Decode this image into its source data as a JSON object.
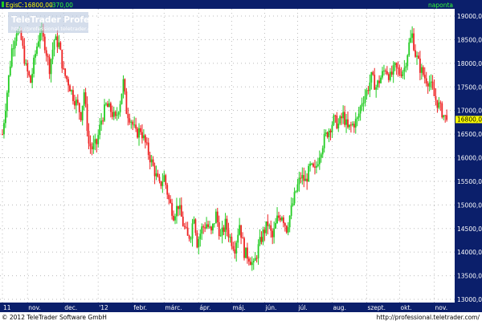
{
  "header": {
    "instrument": "Egis",
    "close_label": "C:",
    "close_value": "16800,00",
    "change": "-370,00",
    "period": "naponta"
  },
  "watermark": {
    "title": "TeleTrader Professional",
    "url": "http://professional.teletrader.com/"
  },
  "footer": {
    "copyright": "© 2012 TeleTrader Software GmbH",
    "url": "http://professional.teletrader.com/"
  },
  "colors": {
    "background": "#ffffff",
    "frame": "#0b1f6b",
    "up": "#22cc22",
    "down": "#ee2222",
    "grid": "#bbbbbb",
    "last_price_bg": "#ffff00",
    "header_text": "#ffff00",
    "header_change": "#33ff33"
  },
  "chart_data": {
    "type": "candlestick",
    "y_ticks": [
      "19000,00",
      "18500,00",
      "18000,00",
      "17500,00",
      "17000,00",
      "16500,00",
      "16000,00",
      "15500,00",
      "15000,00",
      "14500,00",
      "14000,00",
      "13500,00",
      "13000,00"
    ],
    "ylim": [
      13000,
      19000
    ],
    "last_price": 16800,
    "last_price_label": "16800,00",
    "x_ticks": [
      {
        "label": "11",
        "x": 0
      },
      {
        "label": "nov.",
        "x": 16
      },
      {
        "label": "dec.",
        "x": 39
      },
      {
        "label": "'12",
        "x": 61
      },
      {
        "label": "febr.",
        "x": 83
      },
      {
        "label": "márc.",
        "x": 103
      },
      {
        "label": "ápr.",
        "x": 125
      },
      {
        "label": "máj.",
        "x": 146
      },
      {
        "label": "jún.",
        "x": 167
      },
      {
        "label": "júl.",
        "x": 188
      },
      {
        "label": "aug.",
        "x": 210
      },
      {
        "label": "szept.",
        "x": 232
      },
      {
        "label": "okt.",
        "x": 253
      },
      {
        "label": "nov.",
        "x": 275
      }
    ],
    "xlim": [
      0,
      286
    ],
    "trend_points": [
      [
        0,
        16500
      ],
      [
        3,
        17400
      ],
      [
        6,
        18300
      ],
      [
        9,
        18700
      ],
      [
        12,
        18500
      ],
      [
        15,
        17900
      ],
      [
        18,
        17600
      ],
      [
        21,
        18200
      ],
      [
        24,
        18700
      ],
      [
        27,
        18400
      ],
      [
        30,
        17900
      ],
      [
        33,
        18500
      ],
      [
        36,
        18400
      ],
      [
        39,
        17800
      ],
      [
        42,
        17600
      ],
      [
        45,
        17300
      ],
      [
        48,
        17100
      ],
      [
        50,
        16900
      ],
      [
        52,
        17400
      ],
      [
        55,
        16300
      ],
      [
        57,
        16200
      ],
      [
        60,
        16300
      ],
      [
        63,
        16800
      ],
      [
        66,
        17100
      ],
      [
        69,
        17000
      ],
      [
        72,
        16800
      ],
      [
        75,
        17200
      ],
      [
        77,
        17600
      ],
      [
        79,
        17000
      ],
      [
        82,
        16800
      ],
      [
        85,
        16500
      ],
      [
        88,
        16600
      ],
      [
        91,
        16300
      ],
      [
        94,
        16000
      ],
      [
        97,
        15700
      ],
      [
        100,
        15400
      ],
      [
        103,
        15600
      ],
      [
        106,
        15100
      ],
      [
        109,
        14800
      ],
      [
        112,
        15000
      ],
      [
        115,
        14600
      ],
      [
        118,
        14300
      ],
      [
        120,
        14400
      ],
      [
        122,
        14800
      ],
      [
        124,
        14200
      ],
      [
        127,
        14500
      ],
      [
        130,
        14600
      ],
      [
        133,
        14400
      ],
      [
        136,
        14800
      ],
      [
        139,
        14300
      ],
      [
        142,
        14600
      ],
      [
        145,
        14300
      ],
      [
        148,
        14100
      ],
      [
        151,
        14600
      ],
      [
        154,
        14000
      ],
      [
        157,
        13900
      ],
      [
        160,
        13700
      ],
      [
        163,
        14100
      ],
      [
        166,
        14400
      ],
      [
        169,
        14600
      ],
      [
        172,
        14300
      ],
      [
        175,
        14700
      ],
      [
        178,
        14800
      ],
      [
        181,
        14500
      ],
      [
        184,
        14900
      ],
      [
        187,
        15300
      ],
      [
        190,
        15600
      ],
      [
        193,
        15500
      ],
      [
        196,
        15800
      ],
      [
        199,
        15700
      ],
      [
        202,
        16100
      ],
      [
        205,
        16400
      ],
      [
        208,
        16600
      ],
      [
        211,
        16800
      ],
      [
        214,
        16700
      ],
      [
        217,
        16900
      ],
      [
        220,
        16600
      ],
      [
        223,
        16700
      ],
      [
        226,
        16800
      ],
      [
        229,
        17200
      ],
      [
        232,
        17400
      ],
      [
        235,
        17700
      ],
      [
        238,
        17500
      ],
      [
        241,
        17700
      ],
      [
        244,
        17900
      ],
      [
        247,
        17700
      ],
      [
        250,
        17900
      ],
      [
        253,
        17800
      ],
      [
        256,
        17900
      ],
      [
        259,
        18400
      ],
      [
        261,
        18600
      ],
      [
        263,
        18200
      ],
      [
        266,
        17900
      ],
      [
        269,
        17700
      ],
      [
        272,
        17600
      ],
      [
        275,
        17300
      ],
      [
        278,
        17100
      ],
      [
        281,
        16900
      ],
      [
        283,
        16800
      ]
    ]
  }
}
